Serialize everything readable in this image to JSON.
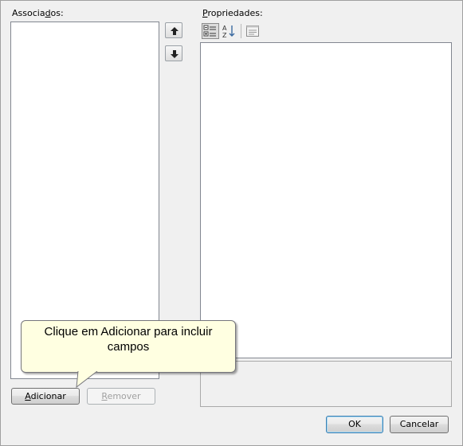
{
  "associados": {
    "label": "Associados:",
    "accel_index": 7
  },
  "propriedades": {
    "label": "Propriedades:",
    "accel_index": 0
  },
  "toolbar": {
    "categorized_icon": "categorized-icon",
    "alphabetical_icon": "sort-az-icon",
    "property_pages_icon": "property-pages-icon"
  },
  "move": {
    "up_icon": "arrow-up-icon",
    "down_icon": "arrow-down-icon"
  },
  "buttons": {
    "adicionar": "Adicionar",
    "remover": "Remover",
    "ok": "OK",
    "cancelar": "Cancelar"
  },
  "tooltip": {
    "line1": "Clique em Adicionar para incluir",
    "line2": "campos"
  },
  "colors": {
    "window_bg": "#f0f0f0",
    "tooltip_bg": "#ffffe1",
    "border": "#828790"
  }
}
